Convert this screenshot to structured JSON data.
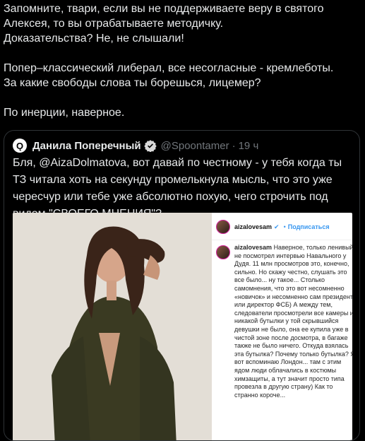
{
  "tweet": {
    "lines": [
      "Запомните, твари, если вы не поддерживаете веру в святого",
      "Алексея, то вы отрабатываете методичку.",
      "Доказательства? Не, не слышали!",
      "",
      "Попер–классический либерал, все несогласные - кремлеботы.",
      "За какие свободы слова ты борешься, лицемер?",
      "",
      "По инерции, наверное."
    ]
  },
  "quote": {
    "author_name": "Данила Поперечный",
    "author_handle": "@Spoontamer",
    "separator": "·",
    "time": "19 ч",
    "body_parts": {
      "prefix": "Бля, ",
      "mention": "@AizaDolmatova",
      "rest": ", вот давай по честному - у тебя когда ты ТЗ читала хоть на секунду промелькнула мысль, что это уже чересчур или тебе уже абсолютно похую, чего строчить под видом \"СВОЕГО МНЕНИЯ\"?"
    },
    "screenshot": {
      "username": "aizalovesam",
      "verified": "✔",
      "follow_sep": "•",
      "follow_label": "Подписаться",
      "comment_user": "aizalovesam",
      "comment_text": "Наверное, только ленивый не посмотрел интервью Навального у Дудя. 11 млн просмотров это, конечно, сильно. Но скажу честно, слушать это все было... ну такое... Столько самомнения, что это вот несомненно «новичок» и несомненно сам президент, или директор ФСБ) А между тем, следователи просмотрели все камеры и никакой бутылки у той скрывшийся девушки не было, она ее купила уже в чистой зоне после досмотра, в багаже также не было ничего. Откуда взялась эта бутылка? Почему только бутылка? Я вот вспоминаю Лондон... там с этим ядом люди облачались в костюмы химзащиты, а тут значит просто типа провезла в другую страну) Как то странно короче..."
    }
  },
  "colors": {
    "background": "#000000",
    "text": "#e7e9ea",
    "muted": "#71767b",
    "border": "#2f3336",
    "verified": "#d9d9d9",
    "link": "#3897f0"
  }
}
